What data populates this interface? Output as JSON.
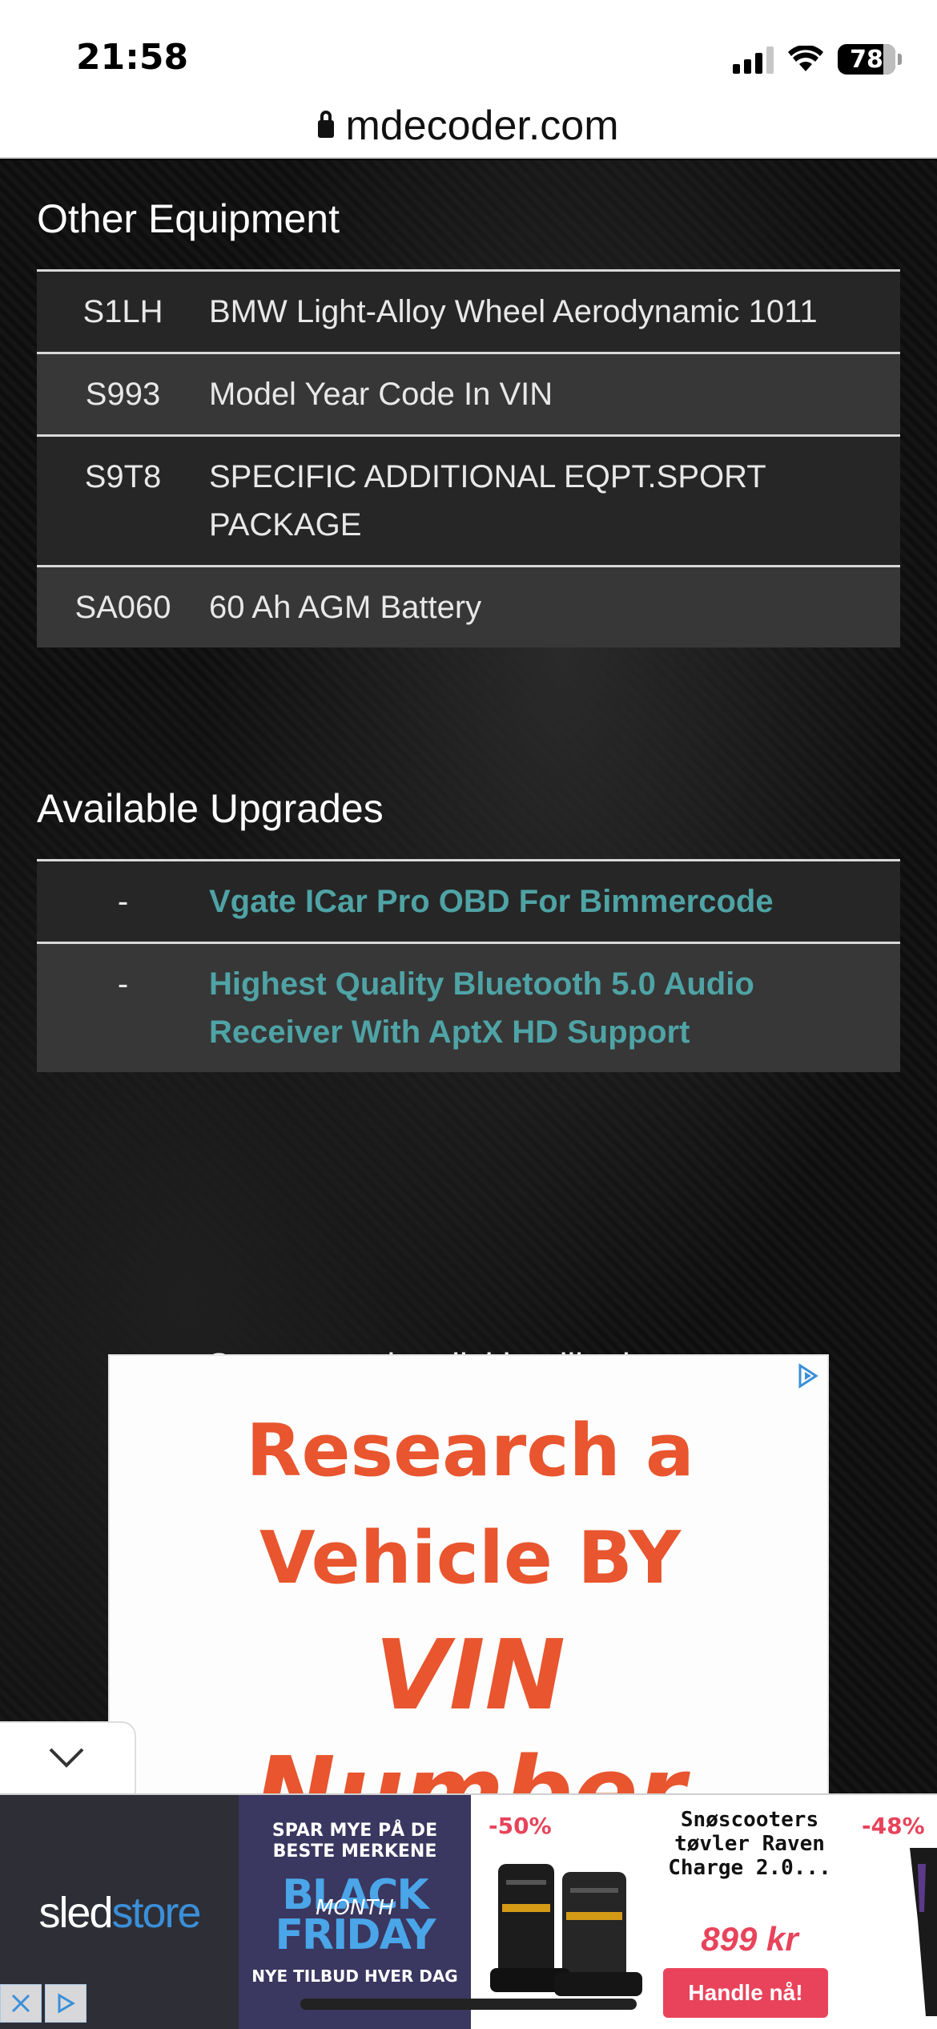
{
  "status_bar": {
    "time": "21:58",
    "battery": "78"
  },
  "browser": {
    "url": "mdecoder.com"
  },
  "other_equipment": {
    "title": "Other Equipment",
    "rows": [
      {
        "code": "S1LH",
        "description": "BMW Light-Alloy Wheel Aerodynamic 1011"
      },
      {
        "code": "S993",
        "description": "Model Year Code In VIN"
      },
      {
        "code": "S9T8",
        "description": "SPECIFIC ADDITIONAL EQPT.SPORT PACKAGE"
      },
      {
        "code": "SA060",
        "description": "60 Ah AGM Battery"
      }
    ]
  },
  "available_upgrades": {
    "title": "Available Upgrades",
    "rows": [
      {
        "code": "-",
        "description": "Vgate ICar Pro OBD For Bimmercode"
      },
      {
        "code": "-",
        "description": "Highest Quality Bluetooth 5.0 Audio Receiver With AptX HD Support"
      }
    ]
  },
  "support_text": "Support us by clicking like button:",
  "ad": {
    "line1": "Research a",
    "line2": "Vehicle BY",
    "line3": "VIN",
    "line4": "Number"
  },
  "banner": {
    "brand_a": "sled",
    "brand_b": "store",
    "promo_top": "SPAR MYE PÅ DE BESTE MERKENE",
    "promo_main_1": "BLACK",
    "promo_main_2": "FRIDAY",
    "promo_script": "MONTH",
    "promo_bottom": "NYE TILBUD HVER DAG",
    "product": {
      "discount": "-50%",
      "name": "Snøscooters tøvler Raven Charge 2.0...",
      "price": "899 kr",
      "cta": "Handle nå!"
    },
    "product2_discount": "-48%"
  },
  "colors": {
    "link": "#4fa3a5",
    "ad_text": "#e8552e",
    "sale": "#e8435b"
  }
}
